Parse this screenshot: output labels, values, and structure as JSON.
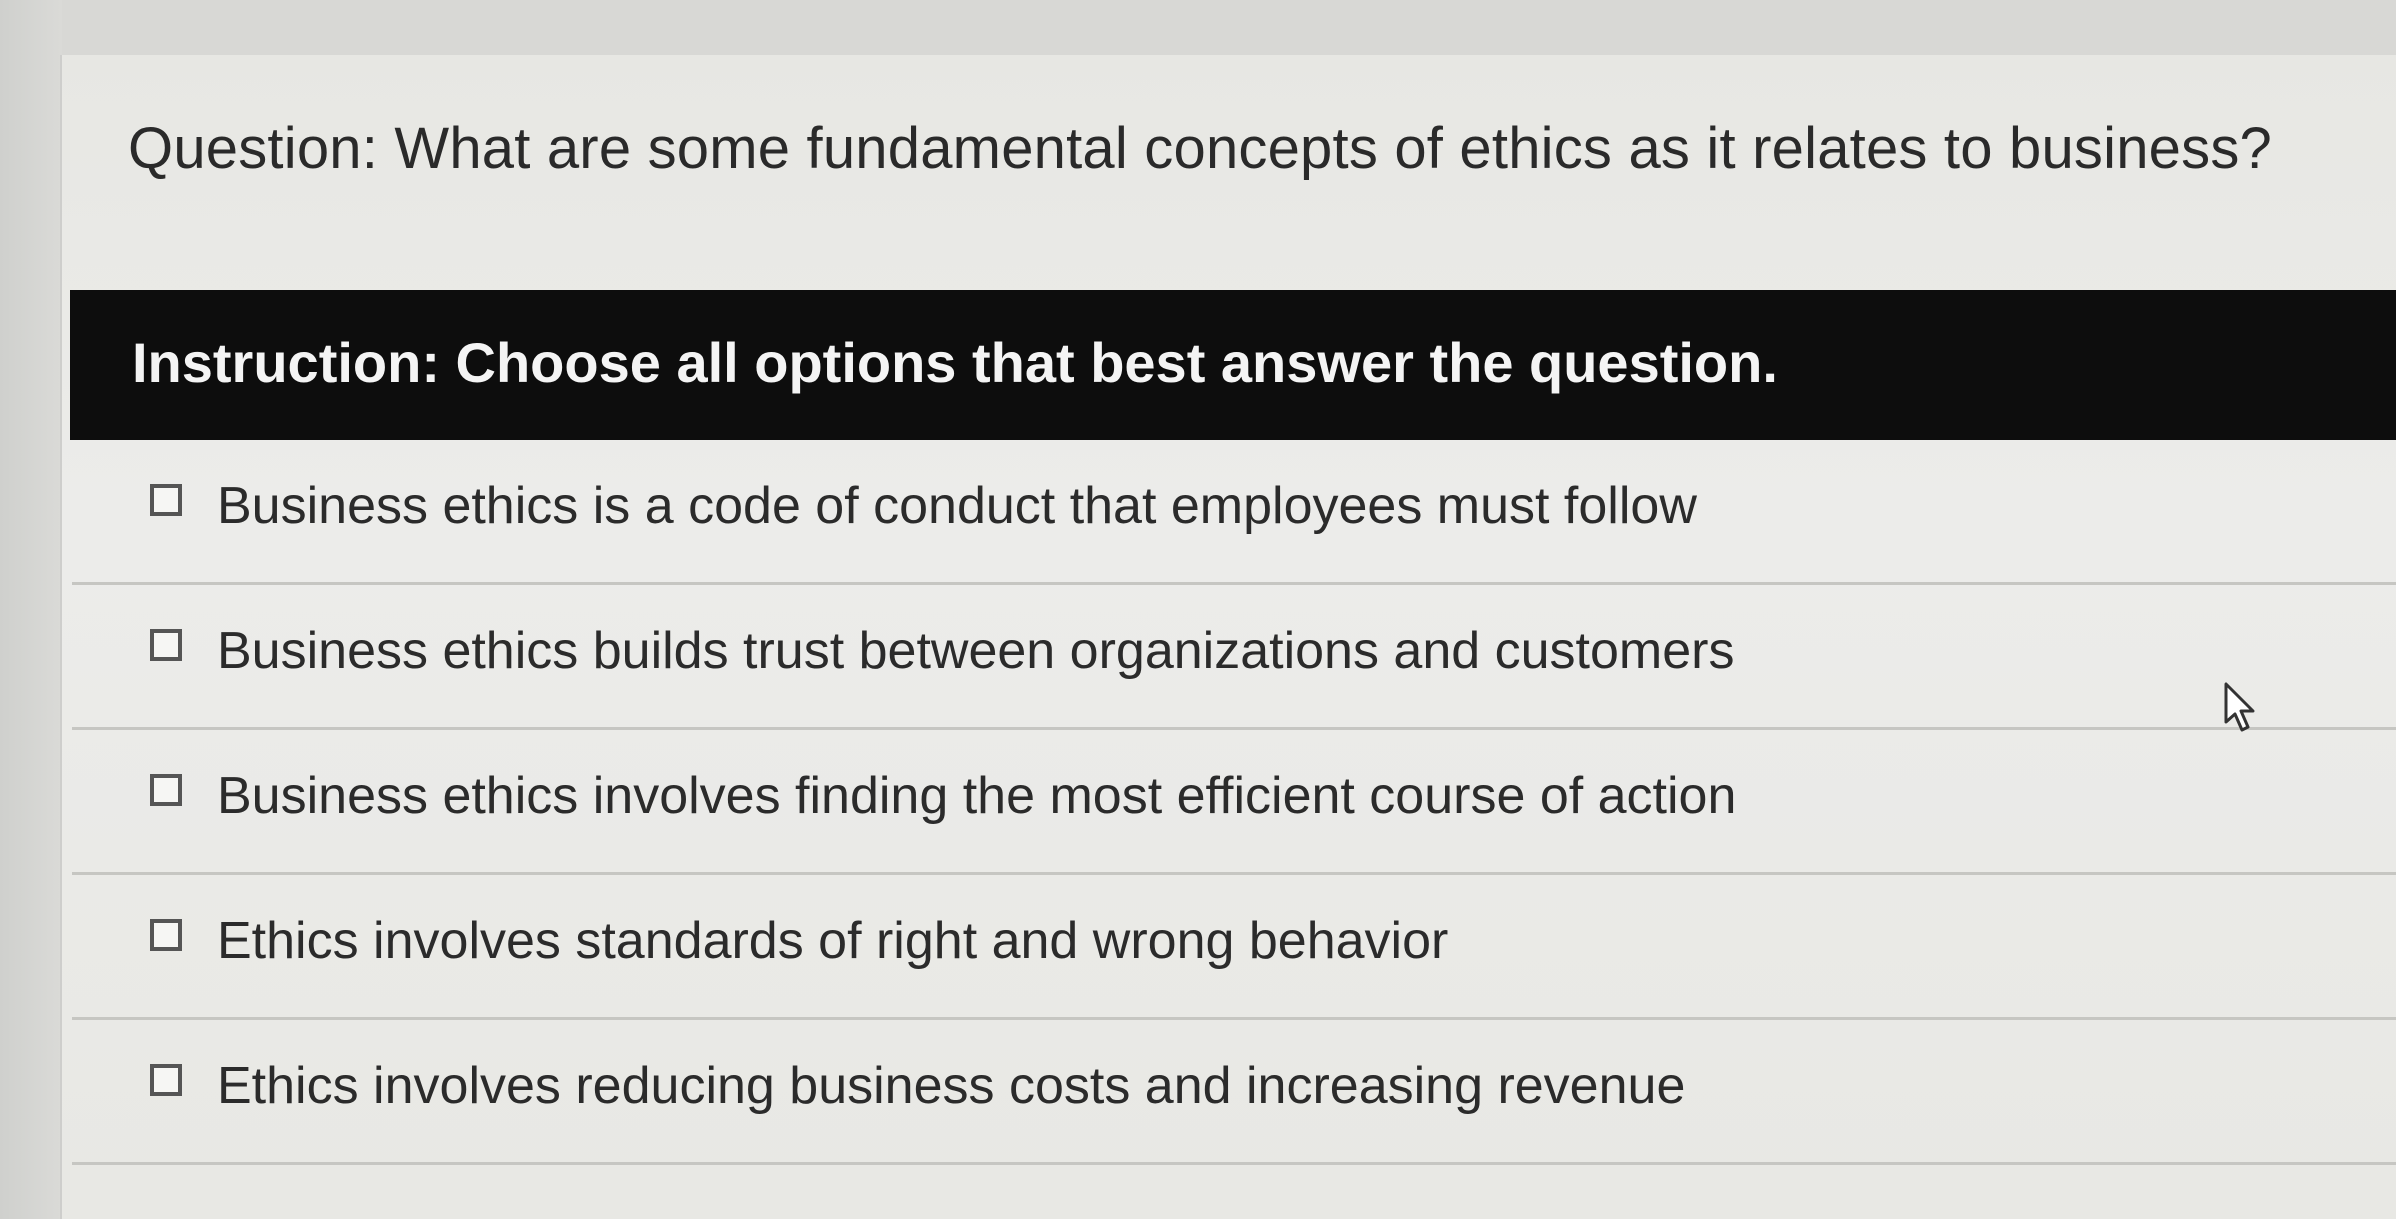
{
  "question": {
    "text": "Question: What are some fundamental concepts of ethics as it relates to business?"
  },
  "instruction": {
    "text": "Instruction: Choose all options that best answer the question."
  },
  "options": [
    {
      "label": "Business ethics is a code of conduct that employees must follow",
      "checked": false
    },
    {
      "label": "Business ethics builds trust between organizations and customers",
      "checked": false
    },
    {
      "label": "Business ethics involves finding the most efficient course of action",
      "checked": false
    },
    {
      "label": "Ethics involves standards of right and wrong behavior",
      "checked": false
    },
    {
      "label": "Ethics involves reducing business costs and increasing revenue",
      "checked": false
    }
  ],
  "icons": {
    "checkbox": "checkbox-unchecked-icon",
    "cursor": "mouse-pointer-icon"
  }
}
